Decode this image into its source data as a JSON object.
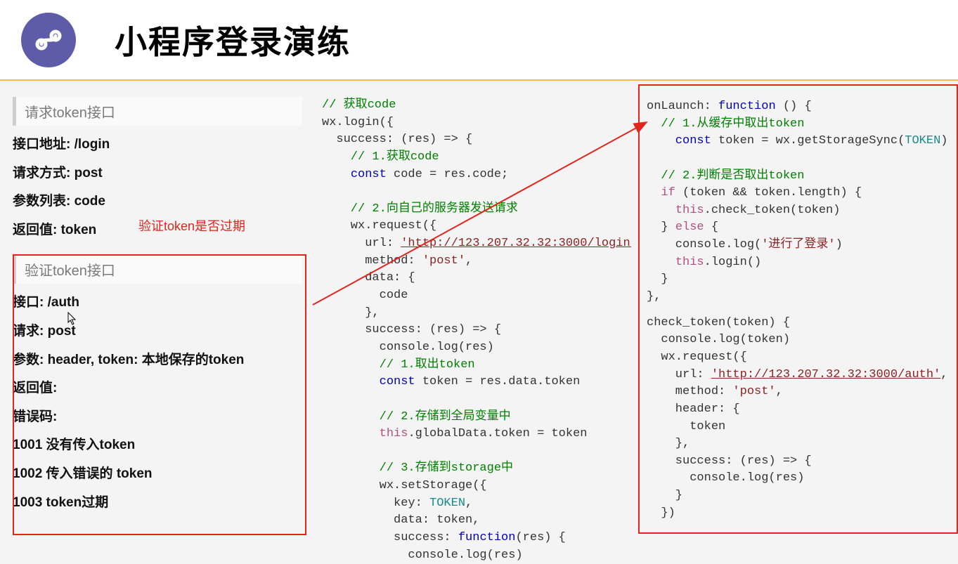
{
  "header": {
    "logo_glyph": "ᔕ",
    "title": "小程序登录演练"
  },
  "left": {
    "request_section": "请求token接口",
    "addr": "接口地址: /login",
    "method": "请求方式: post",
    "params": "参数列表: code",
    "ret": "返回值: token",
    "red_label": "验证token是否过期",
    "verify_section": "验证token接口",
    "v_addr": "接口: /auth",
    "v_method": "请求: post",
    "v_params": "参数: header, token: 本地保存的token",
    "v_ret": "返回值:",
    "errcode_h": "错误码:",
    "err1": "1001 没有传入token",
    "err2": "1002 传入错误的 token",
    "err3": "1003 token过期"
  },
  "middle": {
    "c_getcode": "// 获取code",
    "l_wxlogin": "wx.login({",
    "l_success": "  success: (res) => {",
    "c_getcode2": "    // 1.获取code",
    "l_const_code": "    const code = res.code;",
    "c_send": "    // 2.向自己的服务器发送请求",
    "l_wxrequest": "    wx.request({",
    "l_url_p": "      url: ",
    "url_val": "'http://123.207.32.32:3000/login'",
    "l_method": "      method: 'post',",
    "l_data": "      data: {",
    "l_code": "        code",
    "l_close1": "      },",
    "l_success2": "      success: (res) => {",
    "l_consolelog": "        console.log(res)",
    "c_token1": "        // 1.取出token",
    "l_consttoken": "        const token = res.data.token",
    "c_store": "        // 2.存储到全局变量中",
    "l_global": "        this.globalData.token = token",
    "c_store2": "        // 3.存储到storage中",
    "l_setstorage": "        wx.setStorage({",
    "l_key": "          key: TOKEN,",
    "l_datatoken": "          data: token,",
    "l_successfn": "          success: function(res) {",
    "l_consolelog2": "            console.log(res)"
  },
  "right": {
    "l_onlaunch_a": "onLaunch: ",
    "l_onlaunch_b": "function",
    "l_onlaunch_c": " () {",
    "c_cache": "  // 1.从缓存中取出token",
    "l_consttoken_a": "  const",
    "l_consttoken_b": " token = wx.getStorageSync(",
    "l_consttoken_c": "TOKEN",
    "l_consttoken_d": ")",
    "c_check": "  // 2.判断是否取出token",
    "l_if": "  if (token && token.length) {",
    "l_checktoken": "    this.check_token(token)",
    "l_else": "  } else {",
    "l_log": "    console.log(",
    "l_log_s": "'进行了登录'",
    "l_log_e": ")",
    "l_thislogin": "    this.login()",
    "l_close": "  }",
    "l_close2": "},",
    "l_checktokenfn": "check_token(token) {",
    "l_logtoken": "  console.log(token)",
    "l_wxrequest2": "  wx.request({",
    "l_url2_p": "    url: ",
    "url2_val": "'http://123.207.32.32:3000/auth'",
    "l_method2": "    method: 'post',",
    "l_header": "    header: {",
    "l_tokenh": "      token",
    "l_closeh": "    },",
    "l_success3": "    success: (res) => {",
    "l_log3": "      console.log(res)",
    "l_closes3": "    }",
    "l_closereq": "  })"
  }
}
